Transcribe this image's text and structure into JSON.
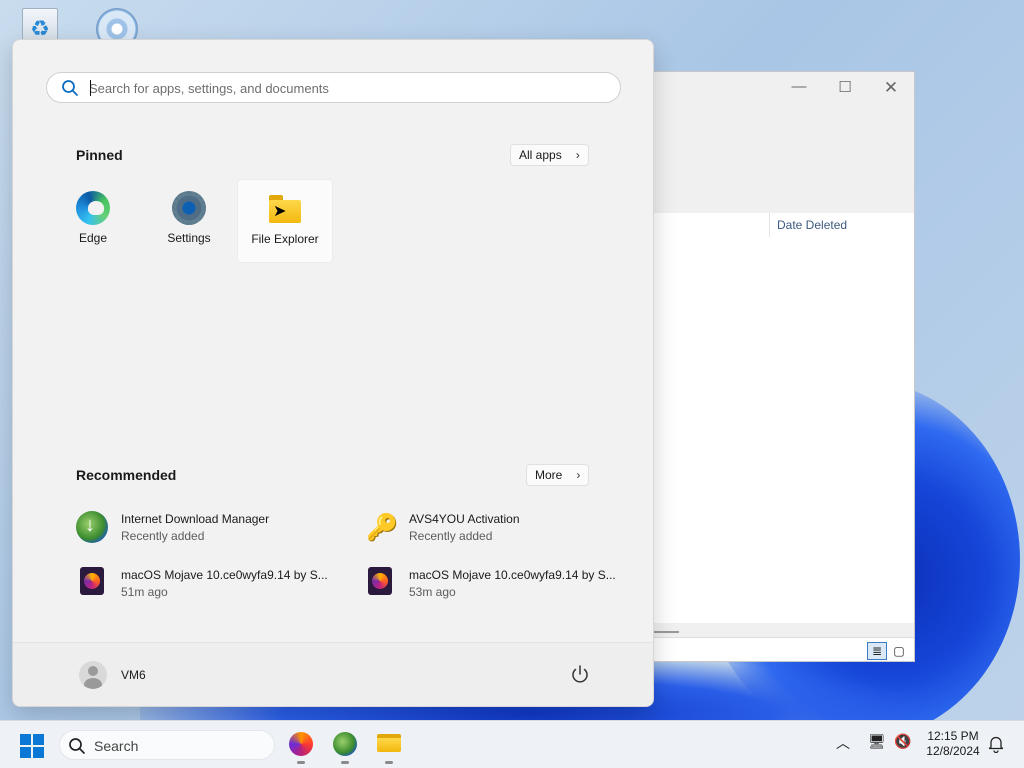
{
  "start_menu": {
    "search_placeholder": "Search for apps, settings, and documents",
    "pinned_title": "Pinned",
    "all_apps_label": "All apps",
    "pinned_apps": [
      {
        "label": "Edge",
        "icon": "edge-icon"
      },
      {
        "label": "Settings",
        "icon": "gear-icon"
      },
      {
        "label": "File Explorer",
        "icon": "folder-icon"
      }
    ],
    "recommended_title": "Recommended",
    "more_label": "More",
    "recommended": [
      {
        "name": "Internet Download Manager",
        "sub": "Recently added",
        "icon": "idm-icon"
      },
      {
        "name": "AVS4YOU Activation",
        "sub": "Recently added",
        "icon": "keys-icon"
      },
      {
        "name": "macOS Mojave 10.ce0wyfa9.14 by S...",
        "sub": "51m ago",
        "icon": "firefox-file-icon"
      },
      {
        "name": "macOS Mojave 10.ce0wyfa9.14 by S...",
        "sub": "53m ago",
        "icon": "firefox-file-icon"
      }
    ],
    "user_name": "VM6"
  },
  "background_window": {
    "column_header": "Date Deleted"
  },
  "taskbar": {
    "search_label": "Search",
    "time": "12:15 PM",
    "date": "12/8/2024",
    "pinned": [
      "firefox-icon",
      "idm-icon",
      "file-explorer-icon"
    ]
  },
  "colors": {
    "accent": "#0a78d4",
    "start_bg": "#f2f2f2",
    "taskbar_bg": "#eef2f6"
  }
}
